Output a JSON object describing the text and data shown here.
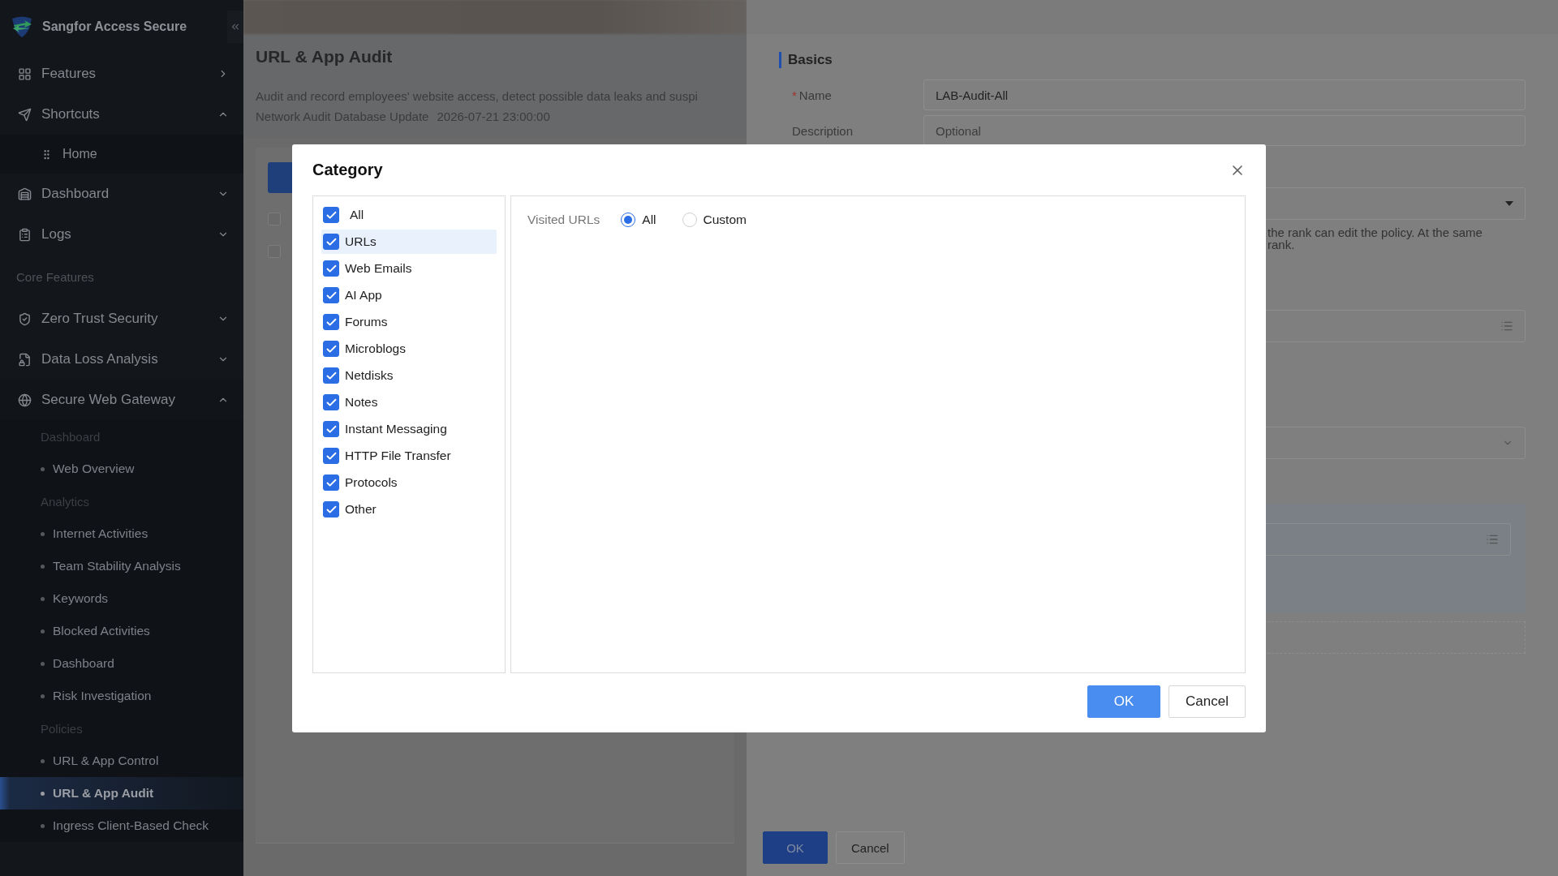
{
  "sidebar": {
    "brand": "Sangfor Access Secure",
    "items": [
      {
        "kind": "flyout",
        "label": "Features"
      },
      {
        "kind": "menu",
        "label": "Shortcuts",
        "expanded": true,
        "children": [
          {
            "kind": "item",
            "label": "Home"
          }
        ]
      },
      {
        "kind": "menu",
        "label": "Dashboard",
        "expanded": false
      },
      {
        "kind": "menu",
        "label": "Logs",
        "expanded": false
      },
      {
        "kind": "heading",
        "label": "Core Features"
      },
      {
        "kind": "menu",
        "label": "Zero Trust Security",
        "expanded": false
      },
      {
        "kind": "menu",
        "label": "Data Loss Analysis",
        "expanded": false
      },
      {
        "kind": "menu",
        "label": "Secure Web Gateway",
        "expanded": true,
        "children": [
          {
            "kind": "group",
            "label": "Dashboard"
          },
          {
            "kind": "leaf",
            "label": "Web Overview",
            "selected": false
          },
          {
            "kind": "group",
            "label": "Analytics"
          },
          {
            "kind": "leaf",
            "label": "Internet Activities",
            "selected": false
          },
          {
            "kind": "leaf",
            "label": "Team Stability Analysis",
            "selected": false
          },
          {
            "kind": "leaf",
            "label": "Keywords",
            "selected": false
          },
          {
            "kind": "leaf",
            "label": "Blocked Activities",
            "selected": false
          },
          {
            "kind": "leaf",
            "label": "Dashboard",
            "selected": false
          },
          {
            "kind": "leaf",
            "label": "Risk Investigation",
            "selected": false
          },
          {
            "kind": "group",
            "label": "Policies"
          },
          {
            "kind": "leaf",
            "label": "URL & App Control",
            "selected": false
          },
          {
            "kind": "leaf",
            "label": "URL & App Audit",
            "selected": true
          },
          {
            "kind": "leaf",
            "label": "Ingress Client-Based Check",
            "selected": false
          }
        ]
      }
    ]
  },
  "page": {
    "title": "URL & App Audit",
    "description": "Audit and record employees' website access, detect possible data leaks and suspi",
    "update_label": "Network Audit Database Update",
    "update_time": "2026-07-21 23:00:00",
    "row_checkboxes": [
      {
        "checked": false
      },
      {
        "checked": false
      }
    ]
  },
  "drawer": {
    "section": "Basics",
    "fields": [
      {
        "label": "Name",
        "required_mark": "*",
        "value": "LAB-Audit-All"
      },
      {
        "label": "Description",
        "placeholder": "Optional"
      }
    ],
    "hint_lines": [
      "the rank can edit the policy. At the same",
      "rank."
    ],
    "buttons": [
      {
        "label": "OK",
        "kind": "primary"
      },
      {
        "label": "Cancel",
        "kind": "default"
      }
    ]
  },
  "dialog": {
    "title": "Category",
    "categories": [
      {
        "label": "All",
        "checked": true,
        "selected": false
      },
      {
        "label": "URLs",
        "checked": true,
        "selected": true
      },
      {
        "label": "Web Emails",
        "checked": true,
        "selected": false
      },
      {
        "label": "AI App",
        "checked": true,
        "selected": false
      },
      {
        "label": "Forums",
        "checked": true,
        "selected": false
      },
      {
        "label": "Microblogs",
        "checked": true,
        "selected": false
      },
      {
        "label": "Netdisks",
        "checked": true,
        "selected": false
      },
      {
        "label": "Notes",
        "checked": true,
        "selected": false
      },
      {
        "label": "Instant Messaging",
        "checked": true,
        "selected": false
      },
      {
        "label": "HTTP File Transfer",
        "checked": true,
        "selected": false
      },
      {
        "label": "Protocols",
        "checked": true,
        "selected": false
      },
      {
        "label": "Other",
        "checked": true,
        "selected": false
      }
    ],
    "visited_urls": {
      "label": "Visited URLs",
      "options": [
        {
          "label": "All",
          "selected": true
        },
        {
          "label": "Custom",
          "selected": false
        }
      ]
    },
    "buttons": [
      {
        "label": "OK",
        "kind": "primary"
      },
      {
        "label": "Cancel",
        "kind": "default"
      }
    ]
  }
}
